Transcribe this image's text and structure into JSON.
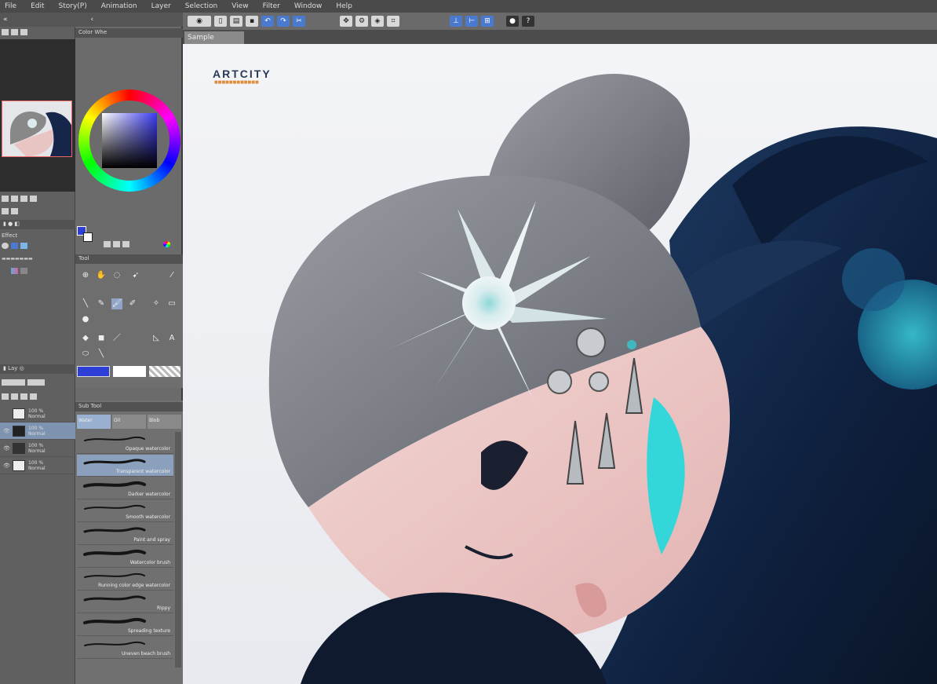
{
  "menu": [
    "File",
    "Edit",
    "Story(P)",
    "Animation",
    "Layer",
    "Selection",
    "View",
    "Filter",
    "Window",
    "Help"
  ],
  "color_panel_title": "Color Whe",
  "canvas_tab": "Sample",
  "logo": {
    "name": "ARTCITY"
  },
  "effect_label": "Effect",
  "tool_panel_title": "Tool",
  "subtool_panel_title": "Sub Tool",
  "subtool_tabs": [
    "Water",
    "Oil",
    "Blob"
  ],
  "brushes": [
    {
      "label": "Opaque watercolor"
    },
    {
      "label": "Transparent watercolor",
      "selected": true
    },
    {
      "label": "Darker watercolor"
    },
    {
      "label": "Smooth watercolor"
    },
    {
      "label": "Paint and spray"
    },
    {
      "label": "Watercolor brush"
    },
    {
      "label": "Running color edge watercolor"
    },
    {
      "label": "Rippy"
    },
    {
      "label": "Spreading texture"
    },
    {
      "label": "Uneven beach brush"
    }
  ],
  "layers": [
    {
      "pct": "100 %",
      "mode": "Normal",
      "selected": false
    },
    {
      "pct": "100 %",
      "mode": "Normal",
      "selected": true
    },
    {
      "pct": "100 %",
      "mode": "Normal",
      "selected": false
    },
    {
      "pct": "100 %",
      "mode": "Normal",
      "selected": false
    }
  ],
  "colors": {
    "foreground": "#2d3fd6",
    "background": "#ffffff"
  }
}
